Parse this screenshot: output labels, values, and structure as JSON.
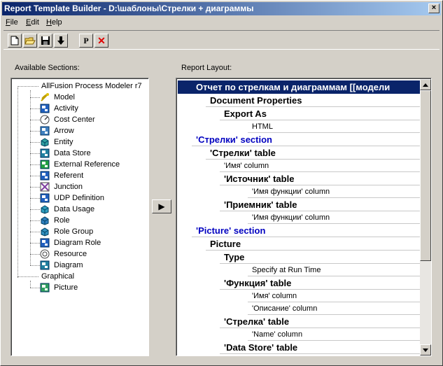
{
  "window": {
    "title": "Report Template Builder - D:\\шаблоны\\Стрелки + диаграммы",
    "close_glyph": "×"
  },
  "menu": [
    {
      "hotkey": "F",
      "rest": "ile"
    },
    {
      "hotkey": "E",
      "rest": "dit"
    },
    {
      "hotkey": "H",
      "rest": "elp"
    }
  ],
  "toolbar": {
    "buttons": [
      "new-document",
      "open-folder",
      "save",
      "move-down",
      "properties",
      "delete"
    ],
    "properties_glyph": "P",
    "delete_glyph": "✕"
  },
  "available_sections": {
    "label": "Available Sections:",
    "root": "AllFusion Process Modeler r7",
    "items": [
      "Model",
      "Activity",
      "Cost Center",
      "Arrow",
      "Entity",
      "Data Store",
      "External Reference",
      "Referent",
      "Junction",
      "UDP Definition",
      "Data Usage",
      "Role",
      "Role Group",
      "Diagram Role",
      "Resource",
      "Diagram"
    ],
    "graphical": "Graphical",
    "graphical_items": [
      "Picture"
    ]
  },
  "report_layout": {
    "label": "Report Layout:",
    "rows": [
      {
        "text": "Отчет по стрелкам и диаграммам [[модели",
        "level": 0,
        "selected": true
      },
      {
        "text": "Document Properties",
        "level": 1
      },
      {
        "text": "Export As",
        "level": 2
      },
      {
        "text": "HTML",
        "level": 3
      },
      {
        "text": "'Стрелки' section",
        "level": 0,
        "blue": true
      },
      {
        "text": "'Стрелки' table",
        "level": 1
      },
      {
        "text": "'Имя' column",
        "level": 2,
        "small": true
      },
      {
        "text": "'Источник' table",
        "level": 2
      },
      {
        "text": "'Имя функции' column",
        "level": 3
      },
      {
        "text": "'Приемник' table",
        "level": 2
      },
      {
        "text": "'Имя функции' column",
        "level": 3
      },
      {
        "text": "'Picture' section",
        "level": 0,
        "blue": true
      },
      {
        "text": "Picture",
        "level": 1
      },
      {
        "text": "Type",
        "level": 2
      },
      {
        "text": "Specify at Run Time",
        "level": 3
      },
      {
        "text": "'Функция' table",
        "level": 2
      },
      {
        "text": "'Имя' column",
        "level": 3
      },
      {
        "text": "'Описание' column",
        "level": 3
      },
      {
        "text": "'Стрелка' table",
        "level": 2
      },
      {
        "text": "'Name' column",
        "level": 3
      },
      {
        "text": "'Data Store' table",
        "level": 2
      }
    ]
  },
  "add_button_glyph": "▶",
  "colors": {
    "titlebar_start": "#0a246a",
    "titlebar_end": "#a6caf0",
    "section_blue": "#0000c0",
    "selection": "#0a246a"
  }
}
